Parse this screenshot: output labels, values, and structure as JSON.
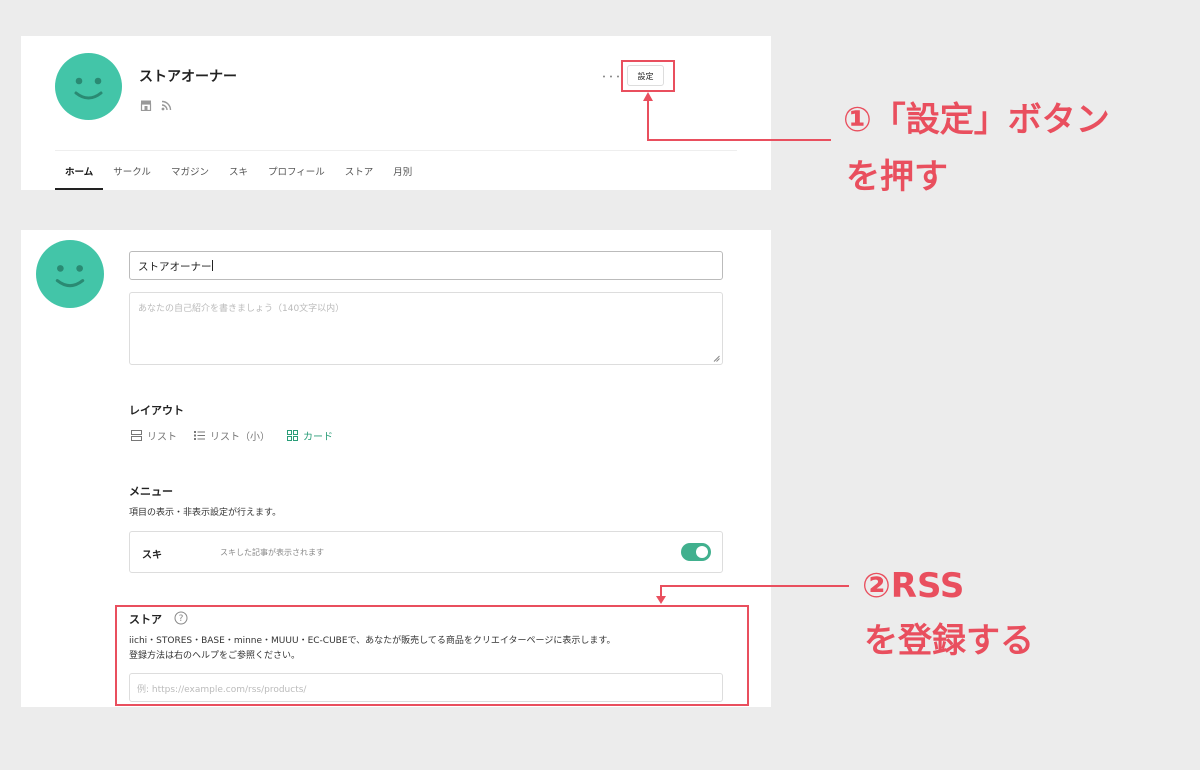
{
  "profile": {
    "name": "ストアオーナー",
    "settings_label": "設定",
    "more_label": "･･･",
    "tabs": [
      {
        "label": "ホーム",
        "active": true
      },
      {
        "label": "サークル"
      },
      {
        "label": "マガジン"
      },
      {
        "label": "スキ"
      },
      {
        "label": "プロフィール"
      },
      {
        "label": "ストア"
      },
      {
        "label": "月別"
      }
    ]
  },
  "edit": {
    "name_value": "ストアオーナー",
    "bio_placeholder": "あなたの自己紹介を書きましょう（140文字以内）",
    "layout": {
      "title": "レイアウト",
      "options": [
        {
          "label": "リスト",
          "icon": "list-icon"
        },
        {
          "label": "リスト（小）",
          "icon": "list-small-icon"
        },
        {
          "label": "カード",
          "icon": "grid-icon",
          "active": true
        }
      ]
    },
    "menu": {
      "title": "メニュー",
      "description": "項目の表示・非表示設定が行えます。",
      "suki": {
        "title": "スキ",
        "description": "スキした記事が表示されます",
        "enabled": true
      }
    },
    "store": {
      "title": "ストア",
      "description_line1": "iichi・STORES・BASE・minne・MUUU・EC-CUBEで、あなたが販売してる商品をクリエイターページに表示します。",
      "description_line2": "登録方法は右のヘルプをご参照ください。",
      "rss_placeholder": "例: https://example.com/rss/products/"
    }
  },
  "annotations": {
    "step1_line1": "①「設定」ボタン",
    "step1_line2": "を押す",
    "step2_line1": "②RSS",
    "step2_line2": "を登録する"
  },
  "colors": {
    "accent": "#43c5a8",
    "toggle": "#41b08e",
    "annotation": "#e94f5e"
  }
}
